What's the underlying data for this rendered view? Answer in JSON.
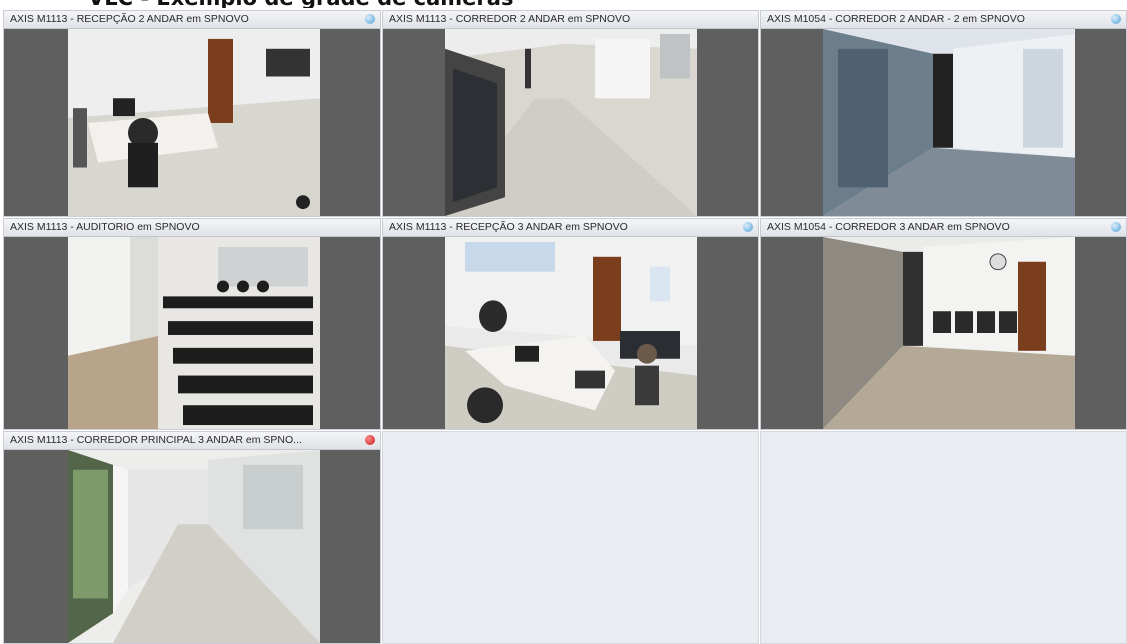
{
  "page_title": "VLC - Exemplo de grade de câmeras",
  "cameras": [
    {
      "title": "AXIS M1113 - RECEPÇÃO 2 ANDAR em SPNOVO",
      "status": "online"
    },
    {
      "title": "AXIS M1113 - CORREDOR 2 ANDAR em SPNOVO",
      "status": "none"
    },
    {
      "title": "AXIS M1054 - CORREDOR 2 ANDAR - 2 em SPNOVO",
      "status": "online"
    },
    {
      "title": "AXIS M1113 - AUDITORIO em SPNOVO",
      "status": "none"
    },
    {
      "title": "AXIS M1113 - RECEPÇÃO 3 ANDAR em SPNOVO",
      "status": "online"
    },
    {
      "title": "AXIS M1054 - CORREDOR 3 ANDAR em SPNOVO",
      "status": "online"
    },
    {
      "title": "AXIS M1113 - CORREDOR PRINCIPAL 3 ANDAR em SPNO...",
      "status": "error"
    }
  ],
  "colors": {
    "status_online": "#4d9fd6",
    "status_error": "#c41a1a",
    "letterbox": "#5f5f5f",
    "empty_cell": "#e9ecf0"
  }
}
